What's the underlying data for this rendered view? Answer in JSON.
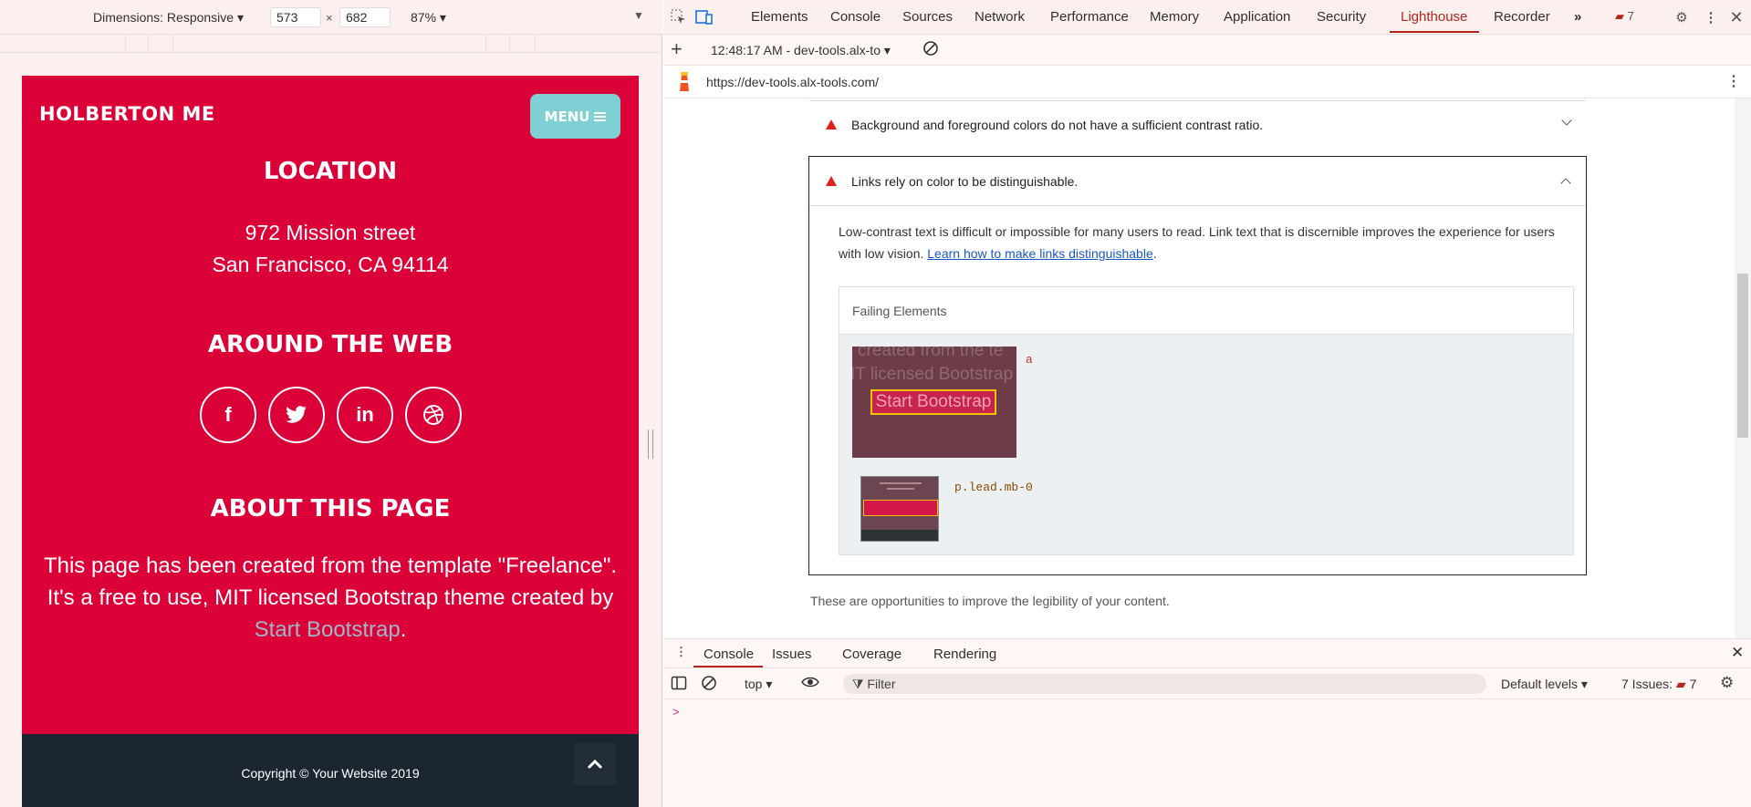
{
  "device_toolbar": {
    "dimensions_label": "Dimensions: Responsive",
    "width": "573",
    "height": "682",
    "times": "×",
    "zoom": "87%"
  },
  "site": {
    "brand": "HOLBERTON ME",
    "menu_label": "MENU",
    "location_title": "LOCATION",
    "address_line1": "972 Mission street",
    "address_line2": "San Francisco, CA 94114",
    "web_title": "AROUND THE WEB",
    "social": [
      {
        "icon": "facebook-icon",
        "glyph": "f"
      },
      {
        "icon": "twitter-icon",
        "glyph": "🐦"
      },
      {
        "icon": "linkedin-icon",
        "glyph": "in"
      },
      {
        "icon": "dribbble-icon",
        "glyph": "◎"
      }
    ],
    "about_title": "ABOUT THIS PAGE",
    "about_text": "This page has been created from the template \"Freelance\". It's a free to use, MIT licensed Bootstrap theme created by",
    "about_link": "Start Bootstrap",
    "about_end": ".",
    "copyright": "Copyright © Your Website 2019",
    "colors": {
      "primary": "#dc0039",
      "accent": "#7ed0d4",
      "footer": "#1c2630",
      "link": "#9fb7c8"
    }
  },
  "devtools": {
    "tabs": [
      "Elements",
      "Console",
      "Sources",
      "Network",
      "Performance",
      "Memory",
      "Application",
      "Security",
      "Lighthouse",
      "Recorder"
    ],
    "active_tab": "Lighthouse",
    "overflow": "»",
    "issues_count": "7",
    "report_time": "12:48:17 AM - dev-tools.alx-to",
    "url": "https://dev-tools.alx-tools.com/",
    "audits": [
      {
        "title": "Background and foreground colors do not have a sufficient contrast ratio.",
        "expanded": false
      },
      {
        "title": "Links rely on color to be distinguishable.",
        "expanded": true
      }
    ],
    "audit_description": "Low-contrast text is difficult or impossible for many users to read. Link text that is discernible improves the experience for users with low vision.",
    "audit_link": "Learn how to make links distinguishable",
    "audit_link_end": ".",
    "failing_header": "Failing Elements",
    "failing": [
      {
        "selector": "a",
        "preview_text": "Start Bootstrap",
        "ghost1": "created from the te",
        "ghost2": "IT licensed Bootstrap"
      },
      {
        "selector": "p.lead.mb-0"
      }
    ],
    "opportunities_note": "These are opportunities to improve the legibility of your content.",
    "drawer_tabs": [
      "Console",
      "Issues",
      "Coverage",
      "Rendering"
    ],
    "active_drawer_tab": "Console",
    "context": "top",
    "filter_placeholder": "Filter",
    "levels": "Default levels",
    "issues_label": "7 Issues:",
    "issues_badge": "7",
    "prompt": ">"
  }
}
